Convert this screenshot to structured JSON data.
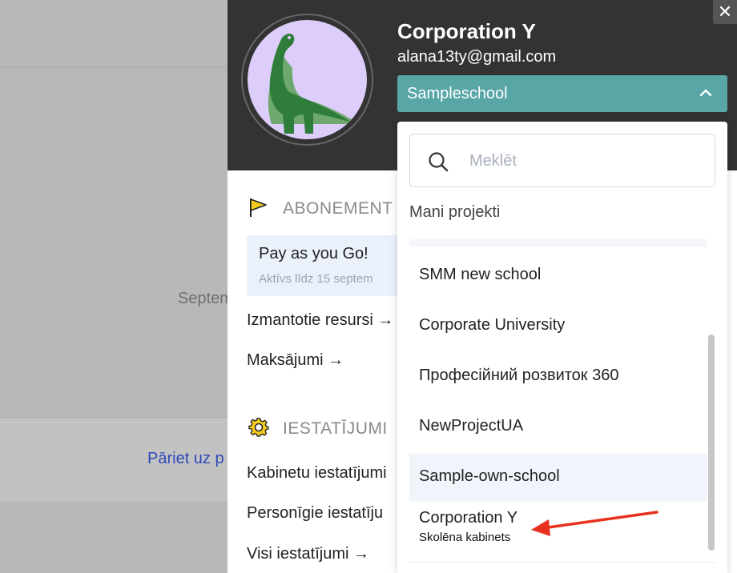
{
  "background": {
    "date_text": "Septem",
    "link_text": "Pāriet uz p"
  },
  "profile": {
    "name": "Corporation Y",
    "email": "alana13ty@gmail.com",
    "close_label": "✕",
    "avatar_colors": {
      "background": "#dccdfa",
      "dino": "#2f7d3a",
      "dino_shadow": "#6fa86f"
    }
  },
  "school_select": {
    "value": "Sampleschool",
    "color": "#58a6a6"
  },
  "sections": {
    "subscription": {
      "title": "ABONEMENT",
      "icon": "flag-icon",
      "plan_name": "Pay as you Go!",
      "plan_sub": "Aktīvs līdz 15 septem",
      "links": [
        "Izmantotie resursi →",
        "Maksājumi →"
      ]
    },
    "settings": {
      "title": "IESTATĪJUMI",
      "icon": "gear-icon",
      "links": [
        "Kabinetu iestatījumi",
        "Personīgie iestatīju",
        "Visi iestatījumi →"
      ]
    }
  },
  "dropdown": {
    "search_placeholder": "Meklēt",
    "heading": "Mani projekti",
    "items": [
      {
        "name": "SMM new school"
      },
      {
        "name": "Corporate University"
      },
      {
        "name": "Професійний розвиток 360"
      },
      {
        "name": "NewProjectUA"
      },
      {
        "name": "Sample-own-school"
      },
      {
        "name": "Corporation Y",
        "sub": "Skolēna kabinets"
      }
    ]
  },
  "annotation": {
    "color": "#e8321f"
  }
}
